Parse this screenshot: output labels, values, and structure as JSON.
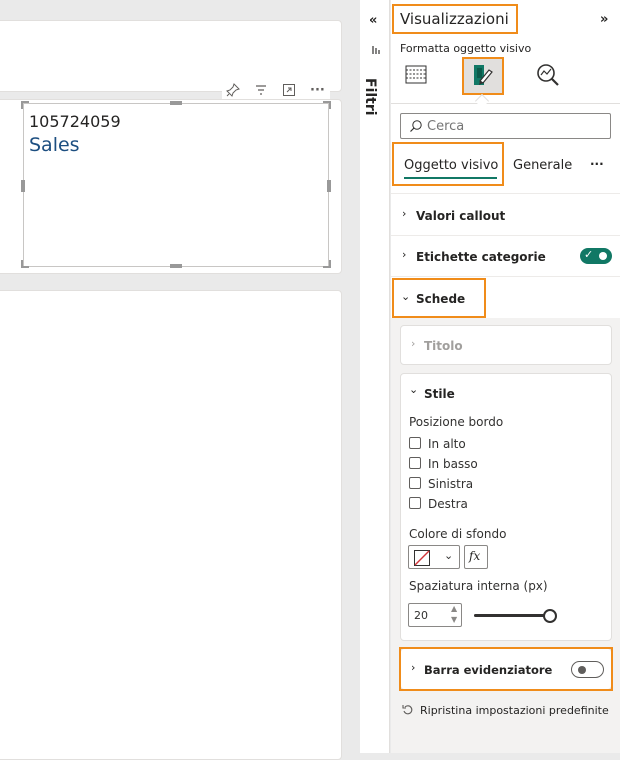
{
  "visual": {
    "value": "105724059",
    "label": "Sales"
  },
  "filters": {
    "label": "Filtri"
  },
  "pane": {
    "title": "Visualizzazioni",
    "subtitle": "Formatta oggetto visivo",
    "search_placeholder": "Cerca",
    "tabs": [
      "Oggetto visivo",
      "Generale"
    ],
    "more": "···",
    "sections": {
      "valori_callout": "Valori callout",
      "etichette_categorie": "Etichette categorie",
      "schede": "Schede",
      "titolo": "Titolo",
      "stile": "Stile",
      "barra_evidenziatore": "Barra evidenziatore"
    },
    "stile": {
      "posizione_bordo": "Posizione bordo",
      "options": [
        "In alto",
        "In basso",
        "Sinistra",
        "Destra"
      ],
      "colore_sfondo": "Colore di sfondo",
      "fx": "fx",
      "spaziatura": "Spaziatura interna (px)",
      "spaziatura_value": "20",
      "spaziatura_level": 1.0
    },
    "reset": "Ripristina impostazioni predefinite"
  },
  "colors": {
    "accent": "#f08c1a",
    "toggle_on": "#117865",
    "tab_underline": "#117865",
    "sales_text": "#1c4e80"
  },
  "icons": {
    "collapse": "chevron-double-left-icon",
    "expand": "chevron-double-right-icon"
  }
}
